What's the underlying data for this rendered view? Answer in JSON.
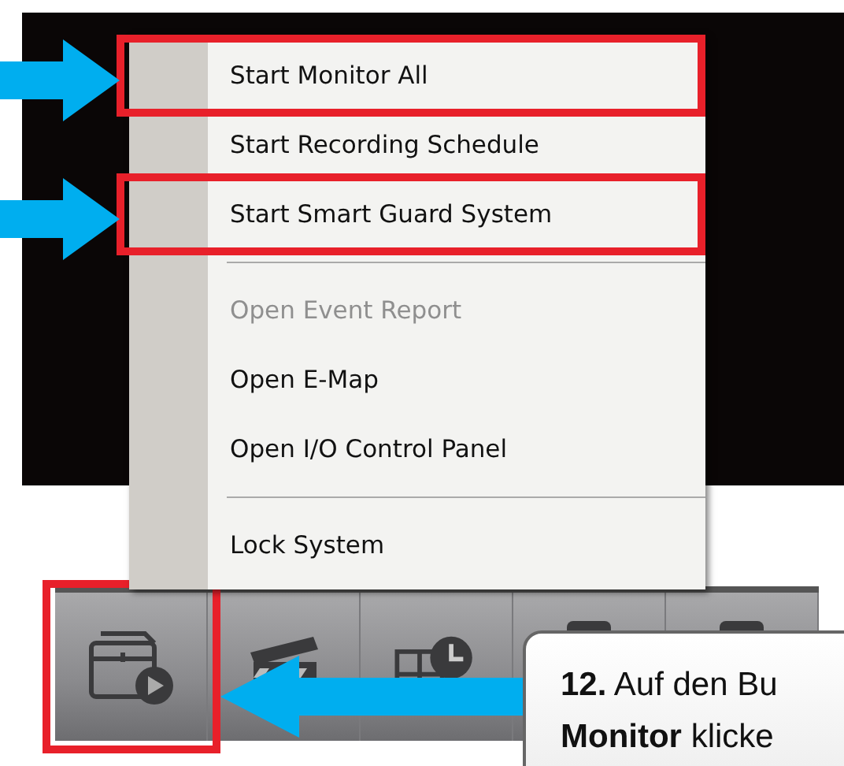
{
  "menu": {
    "items": [
      {
        "kind": "item",
        "label": "Start Monitor All",
        "disabled": false,
        "highlighted": true
      },
      {
        "kind": "item",
        "label": "Start Recording Schedule",
        "disabled": false,
        "highlighted": false
      },
      {
        "kind": "item",
        "label": "Start Smart Guard System",
        "disabled": false,
        "highlighted": true
      },
      {
        "kind": "separator"
      },
      {
        "kind": "item",
        "label": "Open Event Report",
        "disabled": true,
        "highlighted": false
      },
      {
        "kind": "item",
        "label": "Open E-Map",
        "disabled": false,
        "highlighted": false
      },
      {
        "kind": "item",
        "label": "Open I/O Control Panel",
        "disabled": false,
        "highlighted": false
      },
      {
        "kind": "separator"
      },
      {
        "kind": "item",
        "label": "Lock System",
        "disabled": false,
        "highlighted": false
      }
    ]
  },
  "toolbar": {
    "buttons": [
      {
        "kind": "monitor",
        "highlighted": true
      },
      {
        "kind": "clapper",
        "highlighted": false
      },
      {
        "kind": "schedule",
        "highlighted": false
      },
      {
        "kind": "other",
        "highlighted": false
      },
      {
        "kind": "other",
        "highlighted": false
      }
    ]
  },
  "callout": {
    "lines": [
      "**12.** Auf den Bu",
      "**Monitor** klicke"
    ]
  }
}
